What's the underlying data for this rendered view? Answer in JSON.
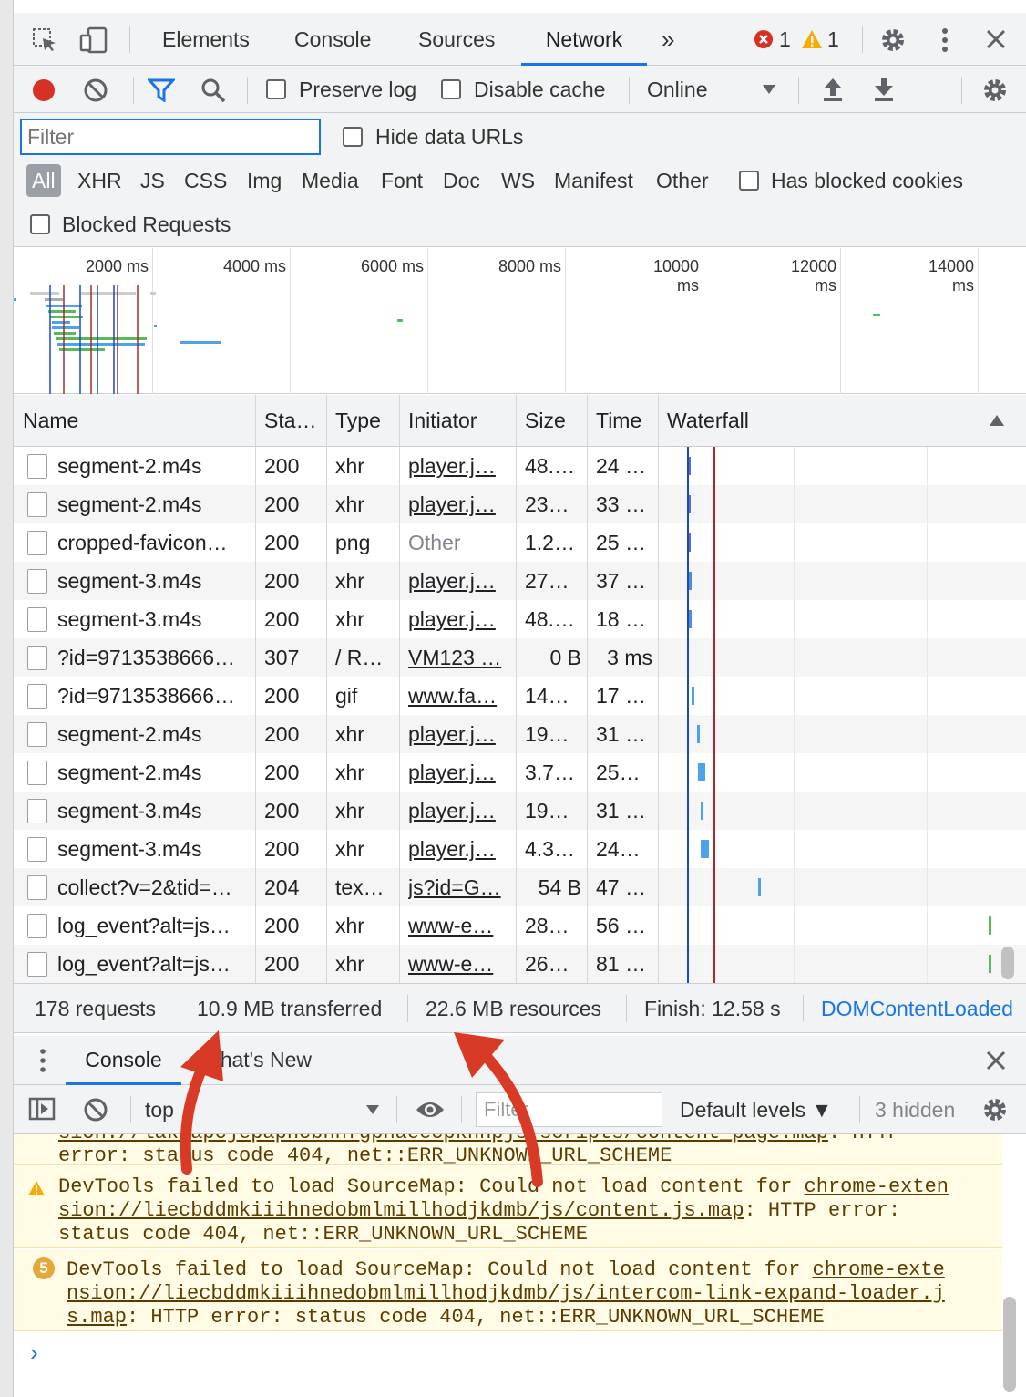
{
  "tabs": {
    "elements": "Elements",
    "console": "Console",
    "sources": "Sources",
    "network": "Network",
    "more": "»",
    "errors_count": "1",
    "warnings_count": "1"
  },
  "toolbar": {
    "preserve_log": "Preserve log",
    "disable_cache": "Disable cache",
    "throttling": "Online"
  },
  "filter": {
    "placeholder": "Filter",
    "hide_data_urls": "Hide data URLs",
    "types": [
      "All",
      "XHR",
      "JS",
      "CSS",
      "Img",
      "Media",
      "Font",
      "Doc",
      "WS",
      "Manifest",
      "Other"
    ],
    "has_blocked_cookies": "Has blocked cookies",
    "blocked_requests": "Blocked Requests"
  },
  "overview": {
    "ticks": [
      "2000 ms",
      "4000 ms",
      "6000 ms",
      "8000 ms",
      "10000 ms",
      "12000 ms",
      "14000 ms"
    ]
  },
  "table": {
    "columns": [
      "Name",
      "Sta…",
      "Type",
      "Initiator",
      "Size",
      "Time",
      "Waterfall"
    ],
    "rows": [
      {
        "name": "segment-2.m4s",
        "status": "200",
        "type": "xhr",
        "initiator": "player.j…",
        "size": "48.…",
        "time": "24 …",
        "initiator_link": true,
        "wf_start": 0.085,
        "wf_width": 0.01,
        "wf_color": "#5b6fb7"
      },
      {
        "name": "segment-2.m4s",
        "status": "200",
        "type": "xhr",
        "initiator": "player.j…",
        "size": "23…",
        "time": "33 …",
        "initiator_link": true,
        "wf_start": 0.086,
        "wf_width": 0.006,
        "wf_color": "#5b6fb7"
      },
      {
        "name": "cropped-favicon…",
        "status": "200",
        "type": "png",
        "initiator": "Other",
        "size": "1.2…",
        "time": "25 …",
        "initiator_link": false,
        "wf_start": 0.086,
        "wf_width": 0.005,
        "wf_color": "#5b6fb7"
      },
      {
        "name": "segment-3.m4s",
        "status": "200",
        "type": "xhr",
        "initiator": "player.j…",
        "size": "27…",
        "time": "37 …",
        "initiator_link": true,
        "wf_start": 0.087,
        "wf_width": 0.01,
        "wf_color": "#4d8fd6"
      },
      {
        "name": "segment-3.m4s",
        "status": "200",
        "type": "xhr",
        "initiator": "player.j…",
        "size": "48.…",
        "time": "18 …",
        "initiator_link": true,
        "wf_start": 0.089,
        "wf_width": 0.008,
        "wf_color": "#4d8fd6"
      },
      {
        "name": "?id=9713538666…",
        "status": "307",
        "type": "/ R…",
        "initiator": "VM123 …",
        "size": "0 B",
        "time": "3 ms",
        "initiator_link": true,
        "wf_start": 0,
        "wf_width": 0,
        "wf_color": "#4d8fd6"
      },
      {
        "name": "?id=9713538666…",
        "status": "200",
        "type": "gif",
        "initiator": "www.fa…",
        "size": "14…",
        "time": "17 …",
        "initiator_link": true,
        "wf_start": 0.098,
        "wf_width": 0.008,
        "wf_color": "#4da3e8"
      },
      {
        "name": "segment-2.m4s",
        "status": "200",
        "type": "xhr",
        "initiator": "player.j…",
        "size": "19…",
        "time": "31 …",
        "initiator_link": true,
        "wf_start": 0.113,
        "wf_width": 0.008,
        "wf_color": "#4da3e8"
      },
      {
        "name": "segment-2.m4s",
        "status": "200",
        "type": "xhr",
        "initiator": "player.j…",
        "size": "3.7…",
        "time": "25…",
        "initiator_link": true,
        "wf_start": 0.117,
        "wf_width": 0.022,
        "wf_color": "#4da3e8"
      },
      {
        "name": "segment-3.m4s",
        "status": "200",
        "type": "xhr",
        "initiator": "player.j…",
        "size": "19…",
        "time": "31 …",
        "initiator_link": true,
        "wf_start": 0.124,
        "wf_width": 0.008,
        "wf_color": "#4da3e8"
      },
      {
        "name": "segment-3.m4s",
        "status": "200",
        "type": "xhr",
        "initiator": "player.j…",
        "size": "4.3…",
        "time": "24…",
        "initiator_link": true,
        "wf_start": 0.125,
        "wf_width": 0.024,
        "wf_color": "#4da3e8"
      },
      {
        "name": "collect?v=2&tid=…",
        "status": "204",
        "type": "tex…",
        "initiator": "js?id=G…",
        "size": "54 B",
        "time": "47 …",
        "initiator_link": true,
        "wf_start": 0.295,
        "wf_width": 0.008,
        "wf_color": "#4da3e8"
      },
      {
        "name": "log_event?alt=js…",
        "status": "200",
        "type": "xhr",
        "initiator": "www-e…",
        "size": "28…",
        "time": "56 …",
        "initiator_link": true,
        "wf_start": 0.983,
        "wf_width": 0.01,
        "wf_color": "#5cb85c"
      },
      {
        "name": "log_event?alt=js…",
        "status": "200",
        "type": "xhr",
        "initiator": "www-e…",
        "size": "26…",
        "time": "81 …",
        "initiator_link": true,
        "wf_start": 0.983,
        "wf_width": 0.01,
        "wf_color": "#5cb85c"
      }
    ]
  },
  "summary": {
    "requests": "178 requests",
    "transferred": "10.9 MB transferred",
    "resources": "22.6 MB resources",
    "finish": "Finish: 12.58 s",
    "dom": "DOMContentLoaded"
  },
  "drawer": {
    "console_tab": "Console",
    "whats_new_tab": "What's New",
    "context": "top",
    "filter_placeholder": "Filter",
    "levels": "Default levels ▼",
    "hidden": "3 hidden"
  },
  "console": {
    "messages": [
      {
        "line1_pre": "",
        "line1_link": "sion://lakeapcjepapncbnhfgpnaeecpkhnpjs/scripts/content_page.map",
        "line1_post": ": HTTP",
        "line2": "error: status code 404, net::ERR_UNKNOWN_URL_SCHEME",
        "line3": ""
      },
      {
        "line1_pre": "DevTools failed to load SourceMap: Could not load content for ",
        "line1_link": "chrome-exten",
        "line2_link": "sion://liecbddmkiiihnedobmlmillhodjkdmb/js/content.js.map",
        "line2_post": ": HTTP error:",
        "line3": "status code 404, net::ERR_UNKNOWN_URL_SCHEME",
        "repeat": ""
      },
      {
        "line1_pre": "DevTools failed to load SourceMap: Could not load content for ",
        "line1_link": "chrome-exte",
        "line2_link": "nsion://liecbddmkiiihnedobmlmillhodjkdmb/js/intercom-link-expand-loader.j",
        "line3_link": "s.map",
        "line3_post": ": HTTP error: status code 404, net::ERR_UNKNOWN_URL_SCHEME",
        "repeat": "5"
      }
    ],
    "prompt": "›"
  },
  "colors": {
    "accent": "#1a73e8",
    "annotation_arrow": "#d93a25",
    "record": "#d93025",
    "warning": "#f9ab00"
  }
}
